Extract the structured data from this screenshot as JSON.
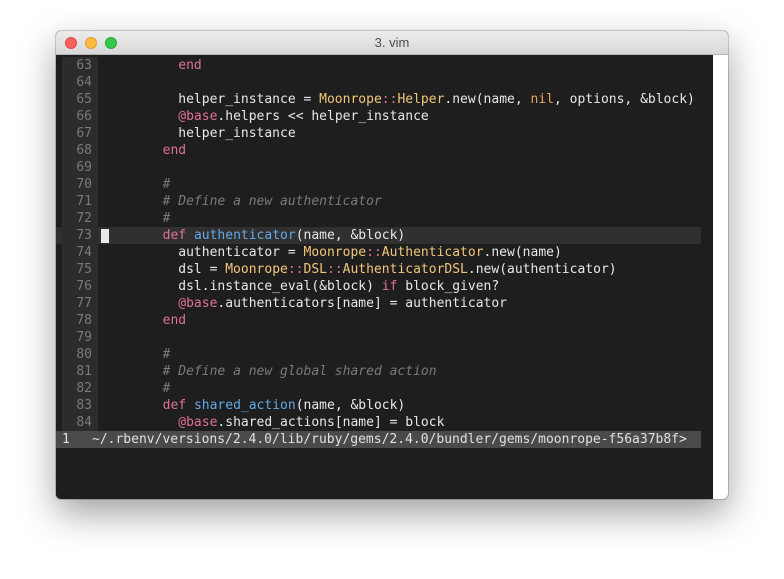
{
  "window": {
    "title": "3. vim"
  },
  "editor": {
    "lines": [
      {
        "num": "63",
        "tokens": [
          {
            "t": "          "
          },
          {
            "t": "end",
            "c": "kw"
          }
        ]
      },
      {
        "num": "64",
        "tokens": []
      },
      {
        "num": "65",
        "tokens": [
          {
            "t": "          helper_instance = "
          },
          {
            "t": "Moonrope",
            "c": "const"
          },
          {
            "t": "::",
            "c": "kw"
          },
          {
            "t": "Helper",
            "c": "const"
          },
          {
            "t": ".new(name, "
          },
          {
            "t": "nil",
            "c": "nil"
          },
          {
            "t": ", options, &block)"
          }
        ]
      },
      {
        "num": "66",
        "tokens": [
          {
            "t": "          "
          },
          {
            "t": "@base",
            "c": "ivar"
          },
          {
            "t": ".helpers << helper_instance"
          }
        ]
      },
      {
        "num": "67",
        "tokens": [
          {
            "t": "          helper_instance"
          }
        ]
      },
      {
        "num": "68",
        "tokens": [
          {
            "t": "        "
          },
          {
            "t": "end",
            "c": "kw"
          }
        ]
      },
      {
        "num": "69",
        "tokens": []
      },
      {
        "num": "70",
        "tokens": [
          {
            "t": "        "
          },
          {
            "t": "#",
            "c": "cm"
          }
        ]
      },
      {
        "num": "71",
        "tokens": [
          {
            "t": "        "
          },
          {
            "t": "# Define a new authenticator",
            "c": "cm"
          }
        ]
      },
      {
        "num": "72",
        "tokens": [
          {
            "t": "        "
          },
          {
            "t": "#",
            "c": "cm"
          }
        ]
      },
      {
        "num": "73",
        "cursor": true,
        "tokens": [
          {
            "t": "        "
          },
          {
            "t": "def",
            "c": "kw"
          },
          {
            "t": " "
          },
          {
            "t": "authenticator",
            "c": "fn"
          },
          {
            "t": "(name, &block)"
          }
        ]
      },
      {
        "num": "74",
        "tokens": [
          {
            "t": "          authenticator = "
          },
          {
            "t": "Moonrope",
            "c": "const"
          },
          {
            "t": "::",
            "c": "kw"
          },
          {
            "t": "Authenticator",
            "c": "const"
          },
          {
            "t": ".new(name)"
          }
        ]
      },
      {
        "num": "75",
        "tokens": [
          {
            "t": "          dsl = "
          },
          {
            "t": "Moonrope",
            "c": "const"
          },
          {
            "t": "::",
            "c": "kw"
          },
          {
            "t": "DSL",
            "c": "const"
          },
          {
            "t": "::",
            "c": "kw"
          },
          {
            "t": "AuthenticatorDSL",
            "c": "const"
          },
          {
            "t": ".new(authenticator)"
          }
        ]
      },
      {
        "num": "76",
        "tokens": [
          {
            "t": "          dsl.instance_eval(&block) "
          },
          {
            "t": "if",
            "c": "kw"
          },
          {
            "t": " block_given?"
          }
        ]
      },
      {
        "num": "77",
        "tokens": [
          {
            "t": "          "
          },
          {
            "t": "@base",
            "c": "ivar"
          },
          {
            "t": ".authenticators[name] = authenticator"
          }
        ]
      },
      {
        "num": "78",
        "tokens": [
          {
            "t": "        "
          },
          {
            "t": "end",
            "c": "kw"
          }
        ]
      },
      {
        "num": "79",
        "tokens": []
      },
      {
        "num": "80",
        "tokens": [
          {
            "t": "        "
          },
          {
            "t": "#",
            "c": "cm"
          }
        ]
      },
      {
        "num": "81",
        "tokens": [
          {
            "t": "        "
          },
          {
            "t": "# Define a new global shared action",
            "c": "cm"
          }
        ]
      },
      {
        "num": "82",
        "tokens": [
          {
            "t": "        "
          },
          {
            "t": "#",
            "c": "cm"
          }
        ]
      },
      {
        "num": "83",
        "tokens": [
          {
            "t": "        "
          },
          {
            "t": "def",
            "c": "kw"
          },
          {
            "t": " "
          },
          {
            "t": "shared_action",
            "c": "fn"
          },
          {
            "t": "(name, &block)"
          }
        ]
      },
      {
        "num": "84",
        "tokens": [
          {
            "t": "          "
          },
          {
            "t": "@base",
            "c": "ivar"
          },
          {
            "t": ".shared_actions[name] = block"
          }
        ]
      }
    ]
  },
  "statusline": {
    "buffer_number": "1",
    "path": "~/.rbenv/versions/2.4.0/lib/ruby/gems/2.4.0/bundler/gems/moonrope-f56a37b8f>"
  },
  "colors": {
    "background": "#1e1e1e",
    "keyword": "#e0709a",
    "function": "#62a8e6",
    "constant": "#f3c57a",
    "nil": "#e5a060",
    "comment": "#7a7a7a"
  }
}
